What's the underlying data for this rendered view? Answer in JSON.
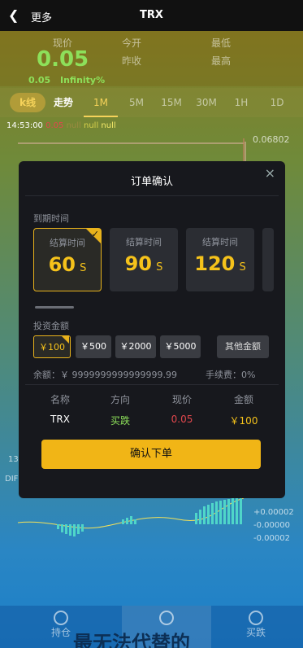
{
  "header": {
    "back_label": "更多",
    "title": "TRX"
  },
  "price": {
    "label_price": "现价",
    "value": "0.05",
    "change": "0.05",
    "change_pct": "Infinity%",
    "label_open": "今开",
    "label_prev": "昨收",
    "label_low": "最低",
    "label_high": "最高"
  },
  "tabs": [
    "k线",
    "走势",
    "1M",
    "5M",
    "15M",
    "30M",
    "1H",
    "1D"
  ],
  "legend": {
    "time": "14:53:00",
    "v1": "0.05",
    "v2": "null",
    "v3": "null",
    "v4": "null"
  },
  "chart": {
    "top_value": "0.06802",
    "right_values": [
      "+0.00002",
      "-0.00000",
      "-0.00002"
    ],
    "left_labels": [
      "13",
      "DIF"
    ]
  },
  "order": {
    "title": "订单确认",
    "expiry_label": "到期时间",
    "cards": [
      {
        "label": "结算时间",
        "value": "60",
        "unit": "S"
      },
      {
        "label": "结算时间",
        "value": "90",
        "unit": "S"
      },
      {
        "label": "结算时间",
        "value": "120",
        "unit": "S"
      }
    ],
    "invest_label": "投资金额",
    "amounts": [
      "￥100",
      "￥500",
      "￥2000",
      "￥5000"
    ],
    "other_amount": "其他金额",
    "balance": "余额：￥ 9999999999999999.99",
    "fee": "手续费：0%",
    "cols": [
      "名称",
      "方向",
      "现价",
      "金额"
    ],
    "vals": [
      "TRX",
      "买跌",
      "0.05",
      "￥100"
    ],
    "confirm": "确认下单"
  },
  "bottom": {
    "items": [
      "持仓",
      "",
      "买跌"
    ]
  },
  "watermark": "最无法代替的",
  "colors": {
    "accent": "#f1b516",
    "green": "#8de05a",
    "red": "#e0474d"
  }
}
